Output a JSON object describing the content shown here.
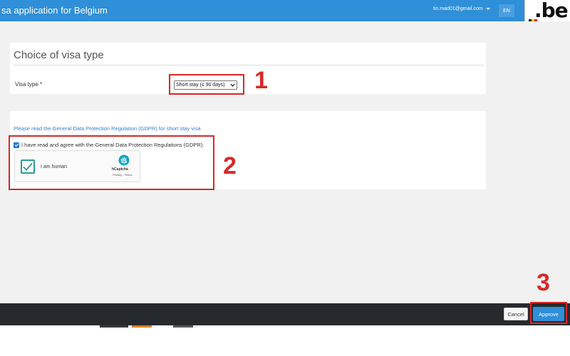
{
  "header": {
    "app_title": "sa application for Belgium",
    "user_email": "tin.mad01@gmail.com",
    "language": "EN",
    "logo_text": ".be",
    "logo_colors": [
      "#111111",
      "#f5c400",
      "#e0202a"
    ],
    "color": "#2f8fd8"
  },
  "visa_card": {
    "title": "Choice of visa type",
    "field_label": "Visa type *",
    "selected_option": "Short stay (≤ 90 days)"
  },
  "gdpr_card": {
    "link_text": "Please read the General Data Protection Regulation (GDPR) for short stay visa",
    "agree_checked": true,
    "agree_text": "I have read and agree with the General Data Protection Regulations (GDPR).",
    "captcha": {
      "label": "I am human",
      "checked": true,
      "brand": "hCaptcha",
      "links": "Privacy - Terms"
    }
  },
  "footer": {
    "cancel_label": "Cancel",
    "approve_label": "Approve"
  },
  "annotations": {
    "steps": [
      "1",
      "2",
      "3"
    ],
    "color": "#d62828"
  }
}
